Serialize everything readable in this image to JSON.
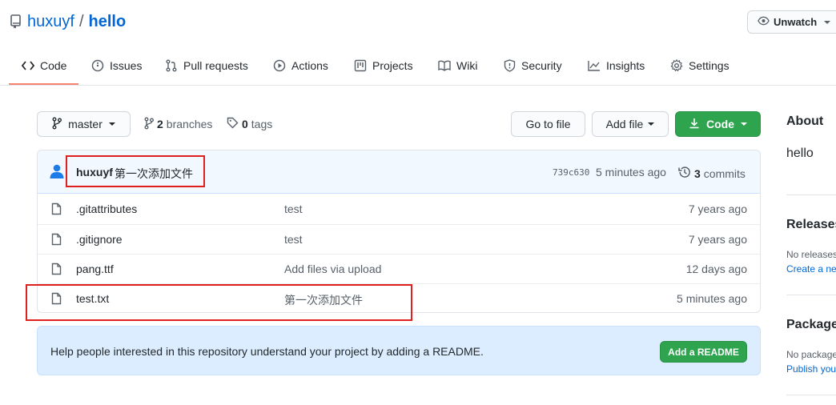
{
  "repo": {
    "owner": "huxuyf",
    "separator": "/",
    "name": "hello"
  },
  "watch": {
    "label": "Unwatch"
  },
  "tabs": [
    {
      "label": "Code",
      "icon": "code-icon"
    },
    {
      "label": "Issues",
      "icon": "issue-icon"
    },
    {
      "label": "Pull requests",
      "icon": "pull-request-icon"
    },
    {
      "label": "Actions",
      "icon": "play-icon"
    },
    {
      "label": "Projects",
      "icon": "project-icon"
    },
    {
      "label": "Wiki",
      "icon": "book-icon"
    },
    {
      "label": "Security",
      "icon": "shield-icon"
    },
    {
      "label": "Insights",
      "icon": "graph-icon"
    },
    {
      "label": "Settings",
      "icon": "gear-icon"
    }
  ],
  "branch": {
    "current": "master"
  },
  "counts": {
    "branches_num": "2",
    "branches_label": "branches",
    "tags_num": "0",
    "tags_label": "tags"
  },
  "actions": {
    "go_to_file": "Go to file",
    "add_file": "Add file",
    "code": "Code"
  },
  "commit": {
    "author": "huxuyf",
    "message": "第一次添加文件",
    "sha": "739c630",
    "time": "5 minutes ago",
    "commits_num": "3",
    "commits_label": "commits"
  },
  "files": [
    {
      "name": ".gitattributes",
      "message": "test",
      "age": "7 years ago"
    },
    {
      "name": ".gitignore",
      "message": "test",
      "age": "7 years ago"
    },
    {
      "name": "pang.ttf",
      "message": "Add files via upload",
      "age": "12 days ago"
    },
    {
      "name": "test.txt",
      "message": "第一次添加文件",
      "age": "5 minutes ago"
    }
  ],
  "readme": {
    "text": "Help people interested in this repository understand your project by adding a README.",
    "button": "Add a README"
  },
  "sidebar": {
    "about_title": "About",
    "about_desc": "hello",
    "releases_title": "Releases",
    "releases_text": "No releases",
    "releases_link": "Create a nev",
    "packages_title": "Packages",
    "packages_text": "No package",
    "packages_link": "Publish you"
  },
  "colors": {
    "accent": "#0366d6",
    "green": "#2ea44f",
    "tab_underline": "#f9826c",
    "annotation": "#e01f1f"
  }
}
